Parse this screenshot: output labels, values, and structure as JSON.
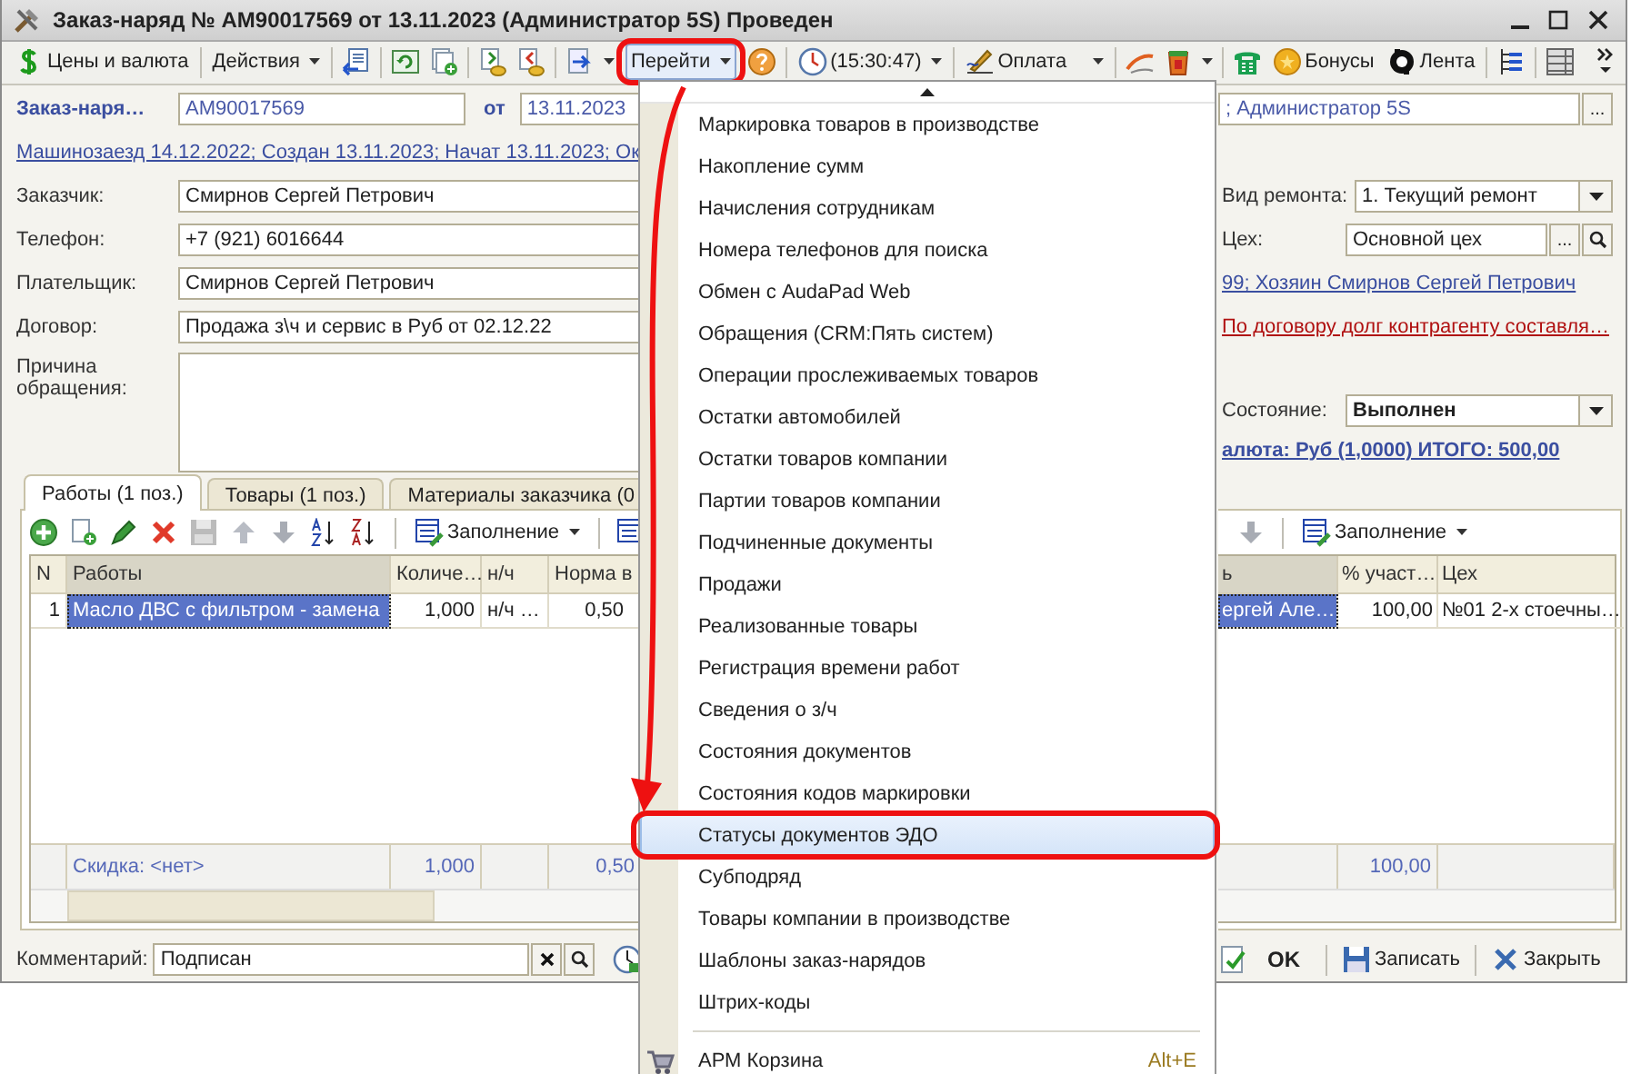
{
  "window": {
    "title": "Заказ-наряд № АМ90017569 от 13.11.2023 (Администратор 5S) Проведен"
  },
  "toolbar": {
    "prices": "Цены и валюта",
    "actions": "Действия",
    "goto": {
      "label": "Перейти",
      "open": true
    },
    "time": "(15:30:47)",
    "payment": "Оплата",
    "bonuses": "Бонусы",
    "tape": "Лента"
  },
  "header": {
    "doc_label": "Заказ-наря…",
    "number": "АМ90017569",
    "date_label": "от",
    "date": "13.11.2023",
    "author": "; Администратор 5S",
    "author_more": "...",
    "history_link": "Машинозаезд 14.12.2022; Создан 13.11.2023; Начат 13.11.2023; Ок"
  },
  "fields": [
    {
      "label": "Заказчик:",
      "value": "Смирнов Сергей Петрович"
    },
    {
      "label": "Телефон:",
      "value": "+7 (921) 6016644"
    },
    {
      "label": "Плательщик:",
      "value": "Смирнов Сергей Петрович"
    },
    {
      "label": "Договор:",
      "value": "Продажа з\\ч и сервис в Руб от 02.12.22"
    }
  ],
  "reason": {
    "label": "Причина обращения:"
  },
  "right": {
    "repair_type": {
      "label": "Вид ремонта:",
      "value": "1. Текущий ремонт"
    },
    "shop": {
      "label": "Цех:",
      "value": "Основной цех",
      "more": "..."
    },
    "owner_link": "99; Хозяин Смирнов Сергей Петрович",
    "debt_link": "По договору долг контрагенту составля…",
    "state": {
      "label": "Состояние:",
      "value": "Выполнен"
    },
    "total_link": "алюта: Руб (1,0000) ИТОГО: 500,00"
  },
  "tabs": [
    {
      "label": "Работы (1 поз.)",
      "selected": true
    },
    {
      "label": "Товары (1 поз.)",
      "selected": false
    },
    {
      "label": "Материалы заказчика (0",
      "selected": false
    }
  ],
  "works_table": {
    "fill_button": "Заполнение",
    "columns": [
      "N",
      "Работы",
      "Количе…",
      "н/ч",
      "Норма в"
    ],
    "rows": [
      {
        "cells": [
          "1",
          "Масло ДВС с фильтром - замена",
          "1,000",
          "н/ч …",
          "0,50"
        ],
        "selected": true
      }
    ],
    "footer": {
      "discount": "Скидка: <нет>",
      "quantity": "1,000",
      "norm": "0,50"
    }
  },
  "executors_table": {
    "fill_button": "Заполнение",
    "columns": [
      "ь",
      "% участ…",
      "Цех"
    ],
    "rows": [
      {
        "cells": [
          "ергей Але…",
          "100,00",
          "№01  2-х стоечны…"
        ],
        "selected": true
      }
    ],
    "footer_total": "100,00"
  },
  "bottom": {
    "comment_label": "Комментарий:",
    "comment": "Подписан",
    "ok": "OK",
    "save": "Записать",
    "close": "Закрыть"
  },
  "menu": {
    "items": [
      {
        "label": "Маркировка товаров в производстве",
        "selected": false
      },
      {
        "label": "Накопление сумм",
        "selected": false
      },
      {
        "label": "Начисления сотрудникам",
        "selected": false
      },
      {
        "label": "Номера телефонов для поиска",
        "selected": false
      },
      {
        "label": "Обмен с AudaPad Web",
        "selected": false
      },
      {
        "label": "Обращения (CRM:Пять систем)",
        "selected": false
      },
      {
        "label": "Операции прослеживаемых товаров",
        "selected": false
      },
      {
        "label": "Остатки автомобилей",
        "selected": false
      },
      {
        "label": "Остатки товаров компании",
        "selected": false
      },
      {
        "label": "Партии товаров компании",
        "selected": false
      },
      {
        "label": "Подчиненные документы",
        "selected": false
      },
      {
        "label": "Продажи",
        "selected": false
      },
      {
        "label": "Реализованные товары",
        "selected": false
      },
      {
        "label": "Регистрация времени работ",
        "selected": false
      },
      {
        "label": "Сведения о з/ч",
        "selected": false
      },
      {
        "label": "Состояния документов",
        "selected": false
      },
      {
        "label": "Состояния кодов маркировки",
        "selected": false
      },
      {
        "label": "Статусы документов ЭДО",
        "selected": true
      },
      {
        "label": "Субподряд",
        "selected": false
      },
      {
        "label": "Товары компании в производстве",
        "selected": false
      },
      {
        "label": "Шаблоны заказ-нарядов",
        "selected": false
      },
      {
        "label": "Штрих-коды",
        "selected": false
      }
    ],
    "command": {
      "label": "АРМ Корзина",
      "shortcut": "Alt+E"
    }
  }
}
